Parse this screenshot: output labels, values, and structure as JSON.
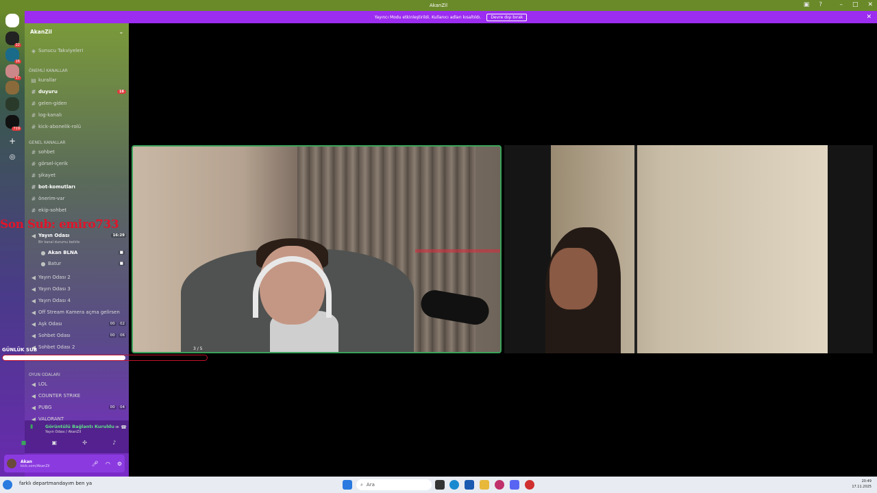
{
  "window": {
    "title": "AkanZil"
  },
  "banner": {
    "message": "Yayıncı Modu etkinleştirildi. Kullanıcı adları kısaltıldı.",
    "button": "Devre dışı bırak"
  },
  "servers": {
    "badges": [
      "22",
      "16",
      "17",
      "719"
    ]
  },
  "sidebar": {
    "server_name": "AkanZil",
    "items": {
      "boosts": "Sunucu Takviyeleri",
      "cat_important": "ÖNEMLİ KANALLAR",
      "kurallar": "kurallar",
      "duyuru": "duyuru",
      "duyuru_count": "16",
      "gelen": "gelen-giden",
      "log": "log-kanalı",
      "kick": "kick-abonelik-rolü",
      "cat_general": "GENEL KANALLAR",
      "sohbet": "sohbet",
      "gorsel": "görsel-içerik",
      "sikayet": "şikayet",
      "bot": "bot-komutları",
      "oneri": "önerim-var",
      "ekip": "ekip-sohbet",
      "yayin1": "Yayın Odası",
      "yayin1_time": "16:29",
      "yayin1_status": "Bir kanal durumu belirle",
      "member1": "Akan",
      "member1_tag": "BLNA",
      "member2": "Batur",
      "yayin2": "Yayın Odası 2",
      "yayin3": "Yayın Odası 3",
      "yayin4": "Yayın Odası 4",
      "offstream": "Off Stream Kamera açma gelirsen",
      "ask": "Aşk Odası",
      "ask_users": "00",
      "ask_max": "02",
      "sohbet_odasi": "Sohbet Odası",
      "sohbet_odasi_users": "00",
      "sohbet_odasi_max": "06",
      "sohbet_odasi2": "Sohbet Odası 2",
      "cat_games": "OYUN ODALARI",
      "lol": "LOL",
      "cs": "COUNTER STRIKE",
      "pubg": "PUBG",
      "pubg_users": "00",
      "pubg_max": "04",
      "valorant": "VALORANT"
    }
  },
  "voice_panel": {
    "status": "Görüntülü Bağlantı Kuruldu",
    "channel": "Yayın Odası / AkanZil"
  },
  "user_panel": {
    "name": "Akan",
    "status": "kick.com/AkanZil"
  },
  "overlay": {
    "last_sub": "Son Sub: emiro733",
    "daily_label": "GÜNLÜK SUB",
    "daily_progress": "3 / 5",
    "daily_fraction": 0.6
  },
  "taskbar": {
    "ticker": "farklı departmandayım ben ya",
    "search_placeholder": "Ara",
    "time": "20:49",
    "date": "17.11.2025"
  }
}
